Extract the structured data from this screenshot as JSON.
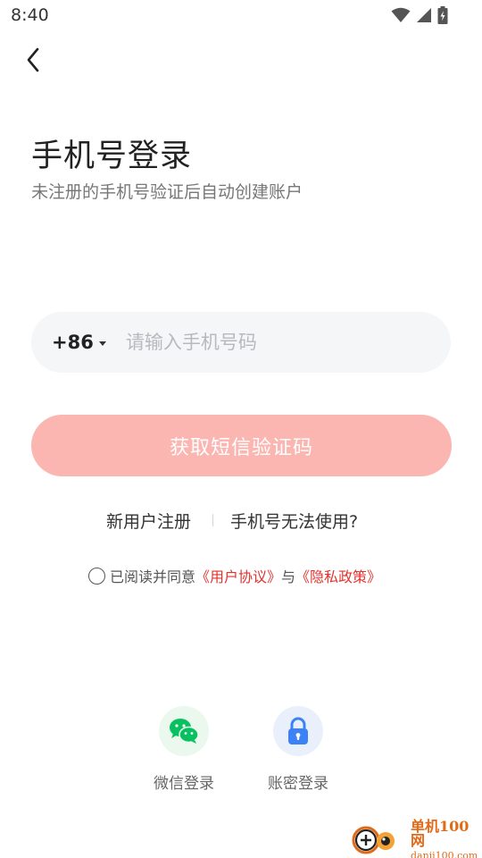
{
  "status_bar": {
    "time": "8:40"
  },
  "header": {
    "title": "手机号登录",
    "subtitle": "未注册的手机号验证后自动创建账户"
  },
  "phone_field": {
    "country_code": "+86",
    "placeholder": "请输入手机号码",
    "value": ""
  },
  "sms_button": {
    "label": "获取短信验证码",
    "color": "#fbb6b1"
  },
  "links": {
    "register": "新用户注册",
    "unavailable": "手机号无法使用?"
  },
  "agreement": {
    "checked": false,
    "prefix": "已阅读并同意",
    "user_agreement": "《用户协议》",
    "conjunction": "与",
    "privacy_policy": "《隐私政策》",
    "link_color": "#e2332e"
  },
  "social_login": [
    {
      "label": "微信登录",
      "icon": "wechat-icon",
      "color": "#07c160"
    },
    {
      "label": "账密登录",
      "icon": "lock-icon",
      "color": "#3b82f6"
    }
  ],
  "watermark": {
    "name": "单机100网",
    "domain": "danji100.com"
  }
}
